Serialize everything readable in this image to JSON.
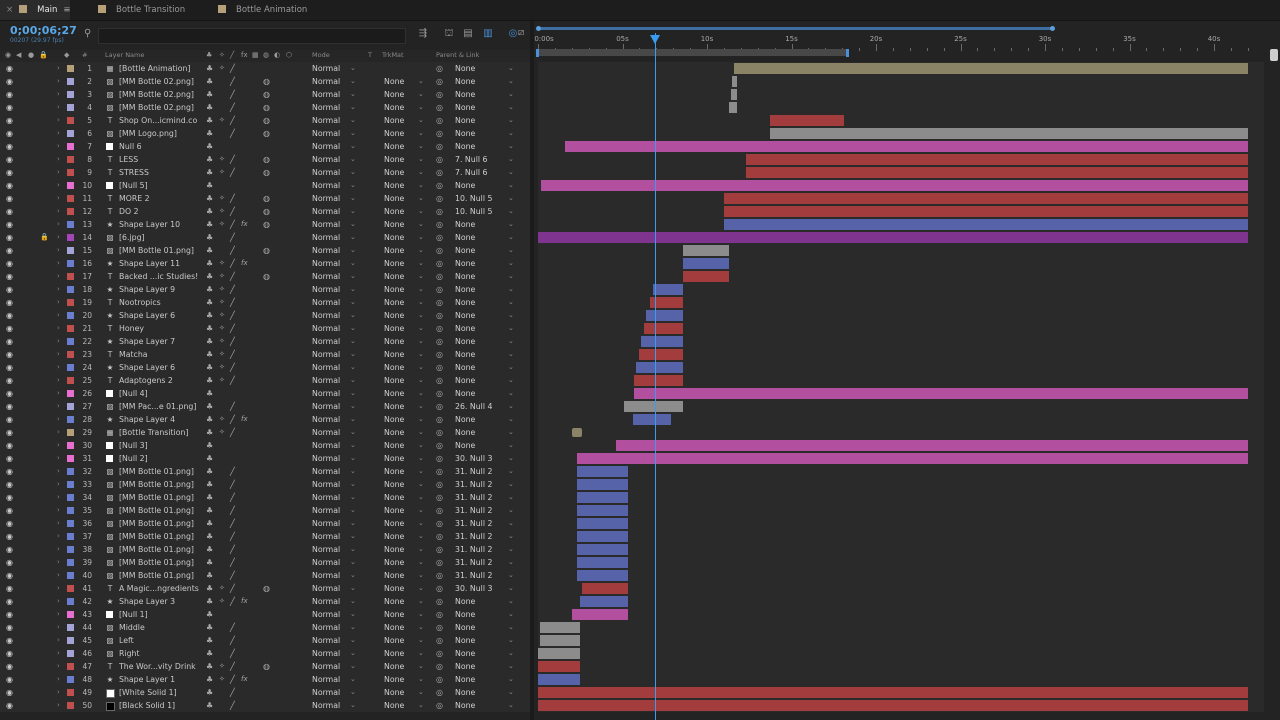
{
  "tabs": [
    {
      "label": "Main",
      "color": "#b5a07a",
      "active": true
    },
    {
      "label": "Bottle Transition",
      "color": "#b5a07a",
      "active": false
    },
    {
      "label": "Bottle Animation",
      "color": "#b5a07a",
      "active": false
    }
  ],
  "header": {
    "timecode": "0;00;06;27",
    "framecode": "00207 (29.97 fps)"
  },
  "columns": {
    "number": "#",
    "layer_name": "Layer Name",
    "mode": "Mode",
    "t": "T",
    "trkmat": "TrkMat",
    "parent": "Parent & Link"
  },
  "ruler": {
    "labels": [
      "0:00s",
      "05s",
      "10s",
      "15s",
      "20s",
      "25s",
      "30s",
      "35s",
      "40s"
    ],
    "total_seconds": 42,
    "work_area_end_seconds": 18.3,
    "current_time_seconds": 6.9
  },
  "layer_colors": {
    "tan": "#b5a07a",
    "lavender": "#a3a3d6",
    "red": "#c05050",
    "pink": "#e86fd0",
    "blue": "#6a7ed0",
    "purple": "#a546b8",
    "white": "#ffffff",
    "black": "#000000"
  },
  "layers": [
    {
      "num": "1",
      "name": "[Bottle Animation]",
      "type": "comp",
      "label": "tan",
      "mode": "Normal",
      "trkmat": "",
      "parent": "None",
      "motion_blur": false,
      "fx": false,
      "locked": false,
      "bar": {
        "start": 11.6,
        "end": 42,
        "color": "#8b8366"
      }
    },
    {
      "num": "2",
      "name": "[MM Bottle 02.png]",
      "type": "footage",
      "label": "lavender",
      "mode": "Normal",
      "trkmat": "None",
      "parent": "None",
      "motion_blur": true,
      "fx": false,
      "locked": false,
      "bar": {
        "start": 11.5,
        "end": 11.8,
        "color": "#8c8c8c"
      }
    },
    {
      "num": "3",
      "name": "[MM Bottle 02.png]",
      "type": "footage",
      "label": "lavender",
      "mode": "Normal",
      "trkmat": "None",
      "parent": "None",
      "motion_blur": true,
      "fx": false,
      "locked": false,
      "bar": {
        "start": 11.4,
        "end": 11.8,
        "color": "#8c8c8c"
      }
    },
    {
      "num": "4",
      "name": "[MM Bottle 02.png]",
      "type": "footage",
      "label": "lavender",
      "mode": "Normal",
      "trkmat": "None",
      "parent": "None",
      "motion_blur": true,
      "fx": false,
      "locked": false,
      "bar": {
        "start": 11.3,
        "end": 11.8,
        "color": "#8c8c8c"
      }
    },
    {
      "num": "5",
      "name": "Shop On...icmind.co",
      "type": "text",
      "label": "red",
      "mode": "Normal",
      "trkmat": "None",
      "parent": "None",
      "motion_blur": true,
      "fx": false,
      "locked": false,
      "bar": {
        "start": 13.7,
        "end": 18.1,
        "color": "#a33c3c"
      }
    },
    {
      "num": "6",
      "name": "[MM Logo.png]",
      "type": "footage",
      "label": "lavender",
      "mode": "Normal",
      "trkmat": "None",
      "parent": "None",
      "motion_blur": true,
      "fx": false,
      "locked": false,
      "bar": {
        "start": 13.7,
        "end": 42,
        "color": "#8c8c8c"
      }
    },
    {
      "num": "7",
      "name": "Null 6",
      "type": "null",
      "label": "pink",
      "mode": "Normal",
      "trkmat": "None",
      "parent": "None",
      "motion_blur": false,
      "fx": false,
      "locked": false,
      "bar": {
        "start": 1.6,
        "end": 42,
        "color": "#b24f9f"
      }
    },
    {
      "num": "8",
      "name": "LESS",
      "type": "text",
      "label": "red",
      "mode": "Normal",
      "trkmat": "None",
      "parent": "7. Null 6",
      "motion_blur": true,
      "fx": false,
      "locked": false,
      "bar": {
        "start": 12.3,
        "end": 42,
        "color": "#a33c3c"
      }
    },
    {
      "num": "9",
      "name": "STRESS",
      "type": "text",
      "label": "red",
      "mode": "Normal",
      "trkmat": "None",
      "parent": "7. Null 6",
      "motion_blur": true,
      "fx": false,
      "locked": false,
      "bar": {
        "start": 12.3,
        "end": 42,
        "color": "#a33c3c"
      }
    },
    {
      "num": "10",
      "name": "[Null 5]",
      "type": "null",
      "label": "pink",
      "mode": "Normal",
      "trkmat": "None",
      "parent": "None",
      "motion_blur": false,
      "fx": false,
      "locked": false,
      "bar": {
        "start": 0.2,
        "end": 42,
        "color": "#b24f9f"
      }
    },
    {
      "num": "11",
      "name": "MORE 2",
      "type": "text",
      "label": "red",
      "mode": "Normal",
      "trkmat": "None",
      "parent": "10. Null 5",
      "motion_blur": true,
      "fx": false,
      "locked": false,
      "bar": {
        "start": 11.0,
        "end": 42,
        "color": "#a33c3c"
      }
    },
    {
      "num": "12",
      "name": "DO 2",
      "type": "text",
      "label": "red",
      "mode": "Normal",
      "trkmat": "None",
      "parent": "10. Null 5",
      "motion_blur": true,
      "fx": false,
      "locked": false,
      "bar": {
        "start": 11.0,
        "end": 42,
        "color": "#a33c3c"
      }
    },
    {
      "num": "13",
      "name": "Shape Layer 10",
      "type": "shape",
      "label": "blue",
      "mode": "Normal",
      "trkmat": "None",
      "parent": "None",
      "motion_blur": true,
      "fx": true,
      "locked": false,
      "bar": {
        "start": 11.0,
        "end": 42,
        "color": "#5763a8"
      }
    },
    {
      "num": "14",
      "name": "[6.jpg]",
      "type": "footage",
      "label": "purple",
      "mode": "Normal",
      "trkmat": "None",
      "parent": "None",
      "motion_blur": false,
      "fx": false,
      "locked": true,
      "bar": {
        "start": 0.0,
        "end": 42,
        "color": "#7f3590"
      }
    },
    {
      "num": "15",
      "name": "[MM Bottle 01.png]",
      "type": "footage",
      "label": "lavender",
      "mode": "Normal",
      "trkmat": "None",
      "parent": "None",
      "motion_blur": true,
      "fx": false,
      "locked": false,
      "bar": {
        "start": 8.6,
        "end": 11.3,
        "color": "#8c8c8c"
      }
    },
    {
      "num": "16",
      "name": "Shape Layer 11",
      "type": "shape",
      "label": "blue",
      "mode": "Normal",
      "trkmat": "None",
      "parent": "None",
      "motion_blur": false,
      "fx": true,
      "locked": false,
      "bar": {
        "start": 8.6,
        "end": 11.3,
        "color": "#5763a8"
      }
    },
    {
      "num": "17",
      "name": "Backed ...ic Studies!",
      "type": "text",
      "label": "red",
      "mode": "Normal",
      "trkmat": "None",
      "parent": "None",
      "motion_blur": true,
      "fx": false,
      "locked": false,
      "bar": {
        "start": 8.6,
        "end": 11.3,
        "color": "#a33c3c"
      }
    },
    {
      "num": "18",
      "name": "Shape Layer 9",
      "type": "shape",
      "label": "blue",
      "mode": "Normal",
      "trkmat": "None",
      "parent": "None",
      "motion_blur": false,
      "fx": false,
      "locked": false,
      "bar": {
        "start": 6.8,
        "end": 8.6,
        "color": "#5763a8"
      }
    },
    {
      "num": "19",
      "name": "Nootropics",
      "type": "text",
      "label": "red",
      "mode": "Normal",
      "trkmat": "None",
      "parent": "None",
      "motion_blur": false,
      "fx": false,
      "locked": false,
      "bar": {
        "start": 6.6,
        "end": 8.6,
        "color": "#a33c3c"
      }
    },
    {
      "num": "20",
      "name": "Shape Layer 6",
      "type": "shape",
      "label": "blue",
      "mode": "Normal",
      "trkmat": "None",
      "parent": "None",
      "motion_blur": false,
      "fx": false,
      "locked": false,
      "bar": {
        "start": 6.4,
        "end": 8.6,
        "color": "#5763a8"
      }
    },
    {
      "num": "21",
      "name": "Honey",
      "type": "text",
      "label": "red",
      "mode": "Normal",
      "trkmat": "None",
      "parent": "None",
      "motion_blur": false,
      "fx": false,
      "locked": false,
      "bar": {
        "start": 6.3,
        "end": 8.6,
        "color": "#a33c3c"
      }
    },
    {
      "num": "22",
      "name": "Shape Layer 7",
      "type": "shape",
      "label": "blue",
      "mode": "Normal",
      "trkmat": "None",
      "parent": "None",
      "motion_blur": false,
      "fx": false,
      "locked": false,
      "bar": {
        "start": 6.1,
        "end": 8.6,
        "color": "#5763a8"
      }
    },
    {
      "num": "23",
      "name": "Matcha",
      "type": "text",
      "label": "red",
      "mode": "Normal",
      "trkmat": "None",
      "parent": "None",
      "motion_blur": false,
      "fx": false,
      "locked": false,
      "bar": {
        "start": 6.0,
        "end": 8.6,
        "color": "#a33c3c"
      }
    },
    {
      "num": "24",
      "name": "Shape Layer 6",
      "type": "shape",
      "label": "blue",
      "mode": "Normal",
      "trkmat": "None",
      "parent": "None",
      "motion_blur": false,
      "fx": false,
      "locked": false,
      "bar": {
        "start": 5.8,
        "end": 8.6,
        "color": "#5763a8"
      }
    },
    {
      "num": "25",
      "name": "Adaptogens 2",
      "type": "text",
      "label": "red",
      "mode": "Normal",
      "trkmat": "None",
      "parent": "None",
      "motion_blur": false,
      "fx": false,
      "locked": false,
      "bar": {
        "start": 5.7,
        "end": 8.6,
        "color": "#a33c3c"
      }
    },
    {
      "num": "26",
      "name": "[Null 4]",
      "type": "null",
      "label": "pink",
      "mode": "Normal",
      "trkmat": "None",
      "parent": "None",
      "motion_blur": false,
      "fx": false,
      "locked": false,
      "bar": {
        "start": 5.7,
        "end": 42,
        "color": "#b24f9f"
      }
    },
    {
      "num": "27",
      "name": "[MM Pac...e 01.png]",
      "type": "footage",
      "label": "lavender",
      "mode": "Normal",
      "trkmat": "None",
      "parent": "26. Null 4",
      "motion_blur": false,
      "fx": false,
      "locked": false,
      "bar": {
        "start": 5.1,
        "end": 8.6,
        "color": "#8c8c8c"
      }
    },
    {
      "num": "28",
      "name": "Shape Layer 4",
      "type": "shape",
      "label": "blue",
      "mode": "Normal",
      "trkmat": "None",
      "parent": "None",
      "motion_blur": false,
      "fx": true,
      "locked": false,
      "bar": {
        "start": 5.6,
        "end": 7.9,
        "color": "#5763a8"
      }
    },
    {
      "num": "29",
      "name": "[Bottle Transition]",
      "type": "comp",
      "label": "tan",
      "mode": "Normal",
      "trkmat": "None",
      "parent": "None",
      "motion_blur": false,
      "fx": false,
      "locked": false,
      "bar": {
        "start": 2.0,
        "end": 2.6,
        "color": "#8b8366"
      }
    },
    {
      "num": "30",
      "name": "[Null 3]",
      "type": "null",
      "label": "pink",
      "mode": "Normal",
      "trkmat": "None",
      "parent": "None",
      "motion_blur": false,
      "fx": false,
      "locked": false,
      "bar": {
        "start": 4.6,
        "end": 42,
        "color": "#b24f9f"
      }
    },
    {
      "num": "31",
      "name": "[Null 2]",
      "type": "null",
      "label": "pink",
      "mode": "Normal",
      "trkmat": "None",
      "parent": "30. Null 3",
      "motion_blur": false,
      "fx": false,
      "locked": false,
      "bar": {
        "start": 2.3,
        "end": 42,
        "color": "#b24f9f"
      }
    },
    {
      "num": "32",
      "name": "[MM Bottle 01.png]",
      "type": "footage",
      "label": "blue",
      "mode": "Normal",
      "trkmat": "None",
      "parent": "31. Null 2",
      "motion_blur": false,
      "fx": false,
      "locked": false,
      "bar": {
        "start": 2.3,
        "end": 5.3,
        "color": "#5763a8"
      }
    },
    {
      "num": "33",
      "name": "[MM Bottle 01.png]",
      "type": "footage",
      "label": "blue",
      "mode": "Normal",
      "trkmat": "None",
      "parent": "31. Null 2",
      "motion_blur": false,
      "fx": false,
      "locked": false,
      "bar": {
        "start": 2.3,
        "end": 5.3,
        "color": "#5763a8"
      }
    },
    {
      "num": "34",
      "name": "[MM Bottle 01.png]",
      "type": "footage",
      "label": "blue",
      "mode": "Normal",
      "trkmat": "None",
      "parent": "31. Null 2",
      "motion_blur": false,
      "fx": false,
      "locked": false,
      "bar": {
        "start": 2.3,
        "end": 5.3,
        "color": "#5763a8"
      }
    },
    {
      "num": "35",
      "name": "[MM Bottle 01.png]",
      "type": "footage",
      "label": "blue",
      "mode": "Normal",
      "trkmat": "None",
      "parent": "31. Null 2",
      "motion_blur": false,
      "fx": false,
      "locked": false,
      "bar": {
        "start": 2.3,
        "end": 5.3,
        "color": "#5763a8"
      }
    },
    {
      "num": "36",
      "name": "[MM Bottle 01.png]",
      "type": "footage",
      "label": "blue",
      "mode": "Normal",
      "trkmat": "None",
      "parent": "31. Null 2",
      "motion_blur": false,
      "fx": false,
      "locked": false,
      "bar": {
        "start": 2.3,
        "end": 5.3,
        "color": "#5763a8"
      }
    },
    {
      "num": "37",
      "name": "[MM Bottle 01.png]",
      "type": "footage",
      "label": "blue",
      "mode": "Normal",
      "trkmat": "None",
      "parent": "31. Null 2",
      "motion_blur": false,
      "fx": false,
      "locked": false,
      "bar": {
        "start": 2.3,
        "end": 5.3,
        "color": "#5763a8"
      }
    },
    {
      "num": "38",
      "name": "[MM Bottle 01.png]",
      "type": "footage",
      "label": "blue",
      "mode": "Normal",
      "trkmat": "None",
      "parent": "31. Null 2",
      "motion_blur": false,
      "fx": false,
      "locked": false,
      "bar": {
        "start": 2.3,
        "end": 5.3,
        "color": "#5763a8"
      }
    },
    {
      "num": "39",
      "name": "[MM Bottle 01.png]",
      "type": "footage",
      "label": "blue",
      "mode": "Normal",
      "trkmat": "None",
      "parent": "31. Null 2",
      "motion_blur": false,
      "fx": false,
      "locked": false,
      "bar": {
        "start": 2.3,
        "end": 5.3,
        "color": "#5763a8"
      }
    },
    {
      "num": "40",
      "name": "[MM Bottle 01.png]",
      "type": "footage",
      "label": "blue",
      "mode": "Normal",
      "trkmat": "None",
      "parent": "31. Null 2",
      "motion_blur": false,
      "fx": false,
      "locked": false,
      "bar": {
        "start": 2.3,
        "end": 5.3,
        "color": "#5763a8"
      }
    },
    {
      "num": "41",
      "name": "A Magic...ngredients",
      "type": "text",
      "label": "red",
      "mode": "Normal",
      "trkmat": "None",
      "parent": "30. Null 3",
      "motion_blur": true,
      "fx": false,
      "locked": false,
      "bar": {
        "start": 2.6,
        "end": 5.3,
        "color": "#a33c3c"
      }
    },
    {
      "num": "42",
      "name": "Shape Layer 3",
      "type": "shape",
      "label": "blue",
      "mode": "Normal",
      "trkmat": "None",
      "parent": "None",
      "motion_blur": false,
      "fx": true,
      "locked": false,
      "bar": {
        "start": 2.5,
        "end": 5.3,
        "color": "#5763a8"
      }
    },
    {
      "num": "43",
      "name": "[Null 1]",
      "type": "null",
      "label": "pink",
      "mode": "Normal",
      "trkmat": "None",
      "parent": "None",
      "motion_blur": false,
      "fx": false,
      "locked": false,
      "bar": {
        "start": 2.0,
        "end": 5.3,
        "color": "#b24f9f"
      }
    },
    {
      "num": "44",
      "name": "Middle",
      "type": "footage",
      "label": "lavender",
      "mode": "Normal",
      "trkmat": "None",
      "parent": "None",
      "motion_blur": false,
      "fx": false,
      "locked": false,
      "bar": {
        "start": 0.1,
        "end": 2.5,
        "color": "#8c8c8c"
      }
    },
    {
      "num": "45",
      "name": "Left",
      "type": "footage",
      "label": "lavender",
      "mode": "Normal",
      "trkmat": "None",
      "parent": "None",
      "motion_blur": false,
      "fx": false,
      "locked": false,
      "bar": {
        "start": 0.1,
        "end": 2.5,
        "color": "#8c8c8c"
      }
    },
    {
      "num": "46",
      "name": "Right",
      "type": "footage",
      "label": "lavender",
      "mode": "Normal",
      "trkmat": "None",
      "parent": "None",
      "motion_blur": false,
      "fx": false,
      "locked": false,
      "bar": {
        "start": 0.0,
        "end": 2.5,
        "color": "#8c8c8c"
      }
    },
    {
      "num": "47",
      "name": "The Wor...vity Drink",
      "type": "text",
      "label": "red",
      "mode": "Normal",
      "trkmat": "None",
      "parent": "None",
      "motion_blur": true,
      "fx": false,
      "locked": false,
      "bar": {
        "start": 0.0,
        "end": 2.5,
        "color": "#a33c3c"
      }
    },
    {
      "num": "48",
      "name": "Shape Layer 1",
      "type": "shape",
      "label": "blue",
      "mode": "Normal",
      "trkmat": "None",
      "parent": "None",
      "motion_blur": false,
      "fx": true,
      "locked": false,
      "bar": {
        "start": 0.0,
        "end": 2.5,
        "color": "#5763a8"
      }
    },
    {
      "num": "49",
      "name": "[White Solid 1]",
      "type": "solid",
      "label": "red",
      "solid_color": "white",
      "mode": "Normal",
      "trkmat": "None",
      "parent": "None",
      "motion_blur": false,
      "fx": false,
      "locked": false,
      "bar": {
        "start": 0.0,
        "end": 42,
        "color": "#a33c3c"
      }
    },
    {
      "num": "50",
      "name": "[Black Solid 1]",
      "type": "solid",
      "label": "red",
      "solid_color": "black",
      "mode": "Normal",
      "trkmat": "None",
      "parent": "None",
      "motion_blur": false,
      "fx": false,
      "locked": false,
      "bar": {
        "start": 0.0,
        "end": 42,
        "color": "#a33c3c"
      }
    }
  ]
}
